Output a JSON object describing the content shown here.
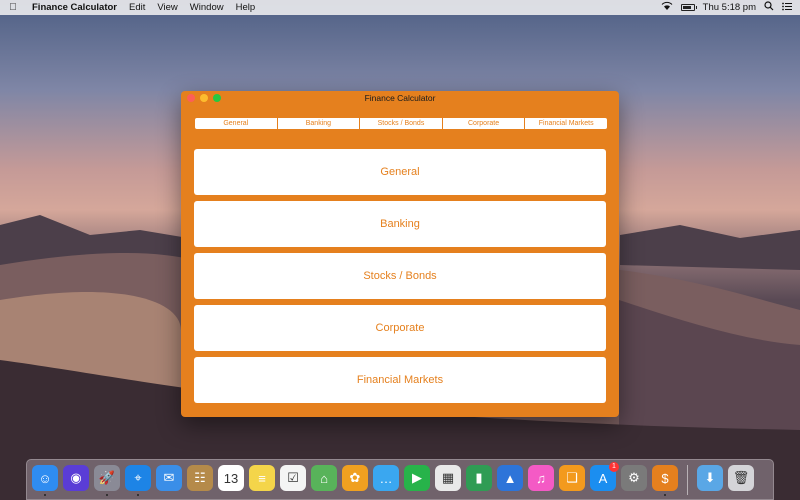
{
  "menubar": {
    "apple_icon": "apple-icon",
    "app_name": "Finance Calculator",
    "menus": [
      "Edit",
      "View",
      "Window",
      "Help"
    ],
    "clock": "Thu 5:18 pm"
  },
  "window": {
    "title": "Finance Calculator",
    "background_color": "#e5801e",
    "segments": [
      "General",
      "Banking",
      "Stocks / Bonds",
      "Corporate",
      "Financial Markets"
    ],
    "buttons": [
      "General",
      "Banking",
      "Stocks / Bonds",
      "Corporate",
      "Financial Markets"
    ]
  },
  "dock": {
    "icons": [
      {
        "name": "finder-icon",
        "glyph": "☺",
        "color": "#2f8cf0"
      },
      {
        "name": "siri-icon",
        "glyph": "◉",
        "color": "#5a3dd6"
      },
      {
        "name": "launchpad-icon",
        "glyph": "🚀",
        "color": "#8a8a96"
      },
      {
        "name": "safari-icon",
        "glyph": "⌖",
        "color": "#1d84e6"
      },
      {
        "name": "mail-icon",
        "glyph": "✉",
        "color": "#3a8ee8"
      },
      {
        "name": "contacts-icon",
        "glyph": "☷",
        "color": "#b58a4a"
      },
      {
        "name": "calendar-icon",
        "glyph": "13",
        "color": "#ffffff"
      },
      {
        "name": "notes-icon",
        "glyph": "≡",
        "color": "#f4d54a"
      },
      {
        "name": "reminders-icon",
        "glyph": "☑",
        "color": "#f4f4f4"
      },
      {
        "name": "maps-icon",
        "glyph": "⌂",
        "color": "#58b35a"
      },
      {
        "name": "photos-icon",
        "glyph": "✿",
        "color": "#f0a020"
      },
      {
        "name": "messages-icon",
        "glyph": "…",
        "color": "#3aa7f0"
      },
      {
        "name": "facetime-icon",
        "glyph": "▶",
        "color": "#27b34a"
      },
      {
        "name": "keynote-slide-icon",
        "glyph": "▦",
        "color": "#e9e9e9"
      },
      {
        "name": "numbers-icon",
        "glyph": "▮",
        "color": "#2f9c54"
      },
      {
        "name": "keynote-icon",
        "glyph": "▲",
        "color": "#2d74d9"
      },
      {
        "name": "itunes-icon",
        "glyph": "♫",
        "color": "#f45ac5"
      },
      {
        "name": "books-icon",
        "glyph": "❑",
        "color": "#f39a1d"
      },
      {
        "name": "app-store-icon",
        "glyph": "A",
        "color": "#1b8ef0",
        "badge": "1"
      },
      {
        "name": "system-preferences-icon",
        "glyph": "⚙",
        "color": "#7a7a7a"
      },
      {
        "name": "finance-calculator-icon",
        "glyph": "$",
        "color": "#e5801e"
      }
    ],
    "right_icons": [
      {
        "name": "downloads-folder-icon",
        "glyph": "⬇",
        "color": "#5aa7e6"
      },
      {
        "name": "trash-icon",
        "glyph": "🗑",
        "color": "#d4d4d8"
      }
    ]
  }
}
